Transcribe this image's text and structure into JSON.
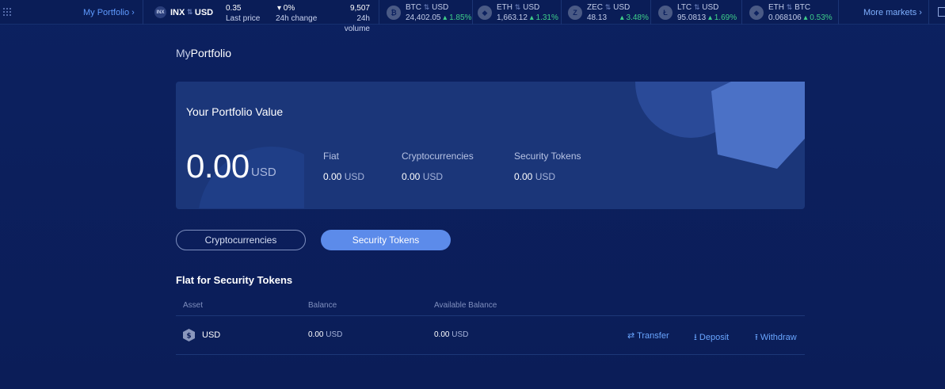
{
  "topbar": {
    "my_portfolio_link": "My Portfolio ›",
    "pair": {
      "base": "INX",
      "quote": "USD",
      "logo": "INX"
    },
    "last_price": {
      "value": "0.35",
      "label": "Last price"
    },
    "change_24h": {
      "value": "▾ 0%",
      "label": "24h change"
    },
    "volume_24h": {
      "value": "9,507",
      "label": "24h volume"
    },
    "tickers": [
      {
        "base": "BTC",
        "quote": "USD",
        "price": "24,402.05",
        "change": "▴ 1.85%",
        "icon": "bitcoin-icon"
      },
      {
        "base": "ETH",
        "quote": "USD",
        "price": "1,663.12",
        "change": "▴ 1.31%",
        "icon": "ethereum-icon"
      },
      {
        "base": "ZEC",
        "quote": "USD",
        "price": "48.13",
        "change": "▴ 3.48%",
        "icon": "zcash-icon"
      },
      {
        "base": "LTC",
        "quote": "USD",
        "price": "95.0813",
        "change": "▴ 1.69%",
        "icon": "litecoin-icon"
      },
      {
        "base": "ETH",
        "quote": "BTC",
        "price": "0.068106",
        "change": "▴ 0.53%",
        "icon": "ethereum-icon"
      }
    ],
    "more_markets": "More markets ›"
  },
  "page": {
    "title_prefix": "My",
    "title_main": "Portfolio"
  },
  "portfolio_card": {
    "title": "Your Portfolio Value",
    "total_value": "0.00",
    "total_unit": "USD",
    "breakdown": [
      {
        "label": "Fiat",
        "value": "0.00",
        "unit": "USD"
      },
      {
        "label": "Cryptocurrencies",
        "value": "0.00",
        "unit": "USD"
      },
      {
        "label": "Security Tokens",
        "value": "0.00",
        "unit": "USD"
      }
    ]
  },
  "tabs": {
    "crypto": "Cryptocurrencies",
    "security": "Security Tokens",
    "active": "security"
  },
  "section": {
    "title": "Flat for Security Tokens",
    "columns": [
      "Asset",
      "Balance",
      "Available Balance"
    ],
    "rows": [
      {
        "asset": "USD",
        "balance": "0.00",
        "balance_unit": "USD",
        "available": "0.00",
        "available_unit": "USD"
      }
    ],
    "actions": {
      "transfer": "⇄ Transfer",
      "deposit": "⭳ Deposit",
      "withdraw": "⭱ Withdraw"
    }
  },
  "colors": {
    "background": "#0b1d58",
    "card": "#1b3679",
    "accent": "#5c8bea",
    "link": "#69a6ff",
    "positive": "#3fd08a"
  }
}
